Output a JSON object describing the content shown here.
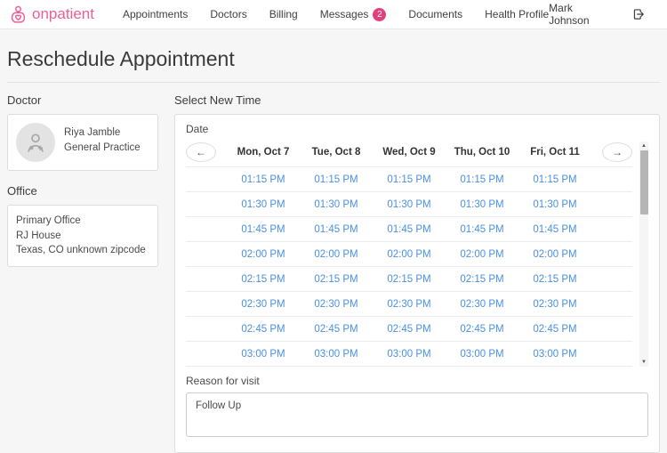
{
  "brand": {
    "name": "onpatient"
  },
  "colors": {
    "brand": "#ef5e99",
    "badge": "#e23f7d",
    "link": "#4a90e2"
  },
  "nav": {
    "items": [
      {
        "label": "Appointments"
      },
      {
        "label": "Doctors"
      },
      {
        "label": "Billing"
      },
      {
        "label": "Messages",
        "badge": "2"
      },
      {
        "label": "Documents"
      },
      {
        "label": "Health Profile"
      }
    ],
    "user": "Mark Johnson"
  },
  "page": {
    "title": "Reschedule Appointment"
  },
  "doctor": {
    "section_label": "Doctor",
    "name": "Riya Jamble",
    "specialty": "General Practice"
  },
  "office": {
    "section_label": "Office",
    "lines": [
      "Primary Office",
      "RJ House",
      "Texas, CO unknown zipcode"
    ]
  },
  "scheduler": {
    "section_label": "Select New Time",
    "date_label": "Date",
    "days": [
      "Mon, Oct 7",
      "Tue, Oct 8",
      "Wed, Oct 9",
      "Thu, Oct 10",
      "Fri, Oct 11"
    ],
    "times": [
      "01:15 PM",
      "01:30 PM",
      "01:45 PM",
      "02:00 PM",
      "02:15 PM",
      "02:30 PM",
      "02:45 PM",
      "03:00 PM"
    ],
    "reason_label": "Reason for visit",
    "reason_value": "Follow Up"
  },
  "icons": {
    "prev_arrow": "←",
    "next_arrow": "→",
    "scroll_up": "▲",
    "scroll_down": "▼"
  }
}
